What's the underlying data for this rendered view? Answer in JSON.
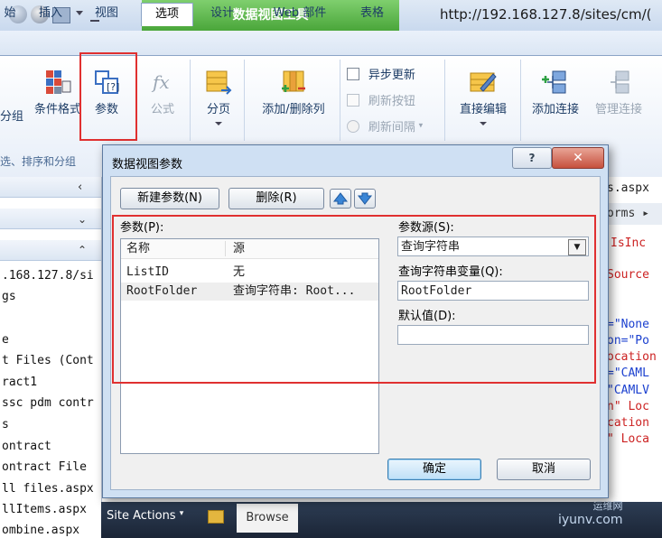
{
  "window": {
    "tool_tab": "数据视图工具",
    "url": "http://192.168.127.8/sites/cm/("
  },
  "ribbon_tabs": [
    {
      "label": "始"
    },
    {
      "label": "插入"
    },
    {
      "label": "视图"
    },
    {
      "label": "选项",
      "active": true
    },
    {
      "label": "设计"
    },
    {
      "label": "Web 部件"
    },
    {
      "label": "表格"
    }
  ],
  "ribbon": {
    "fen_zu": "分组",
    "conditional_format": "条件格式",
    "parameters": "参数",
    "formula": "公式",
    "paging": "分页",
    "add_remove_columns": "添加/删除列",
    "async_update": "异步更新",
    "refresh_button": "刷新按钮",
    "refresh_interval": "刷新间隔",
    "inline_edit": "直接编辑",
    "add_connection": "添加连接",
    "manage_connection": "管理连接",
    "group_label": "选、排序和分组"
  },
  "left_panel": {
    "lines": [
      ".168.127.8/si",
      "gs",
      "e",
      "t Files (Cont",
      "ract1",
      "ssc pdm contr",
      "s",
      "ontract",
      "ontract File",
      "ll files.aspx",
      "llItems.aspx",
      "ombine.aspx"
    ]
  },
  "right_panel": {
    "tab_label": "s.aspx",
    "breadcrumb": "orms",
    "lines": [
      {
        "text": "IsInc",
        "color": "#cc2222"
      },
      {
        "text": "Source",
        "color": "#cc2222"
      },
      {
        "text": "=\"None",
        "color": "#1a3fcf"
      },
      {
        "text": "on=\"Po",
        "color": "#1a3fcf"
      },
      {
        "text": "ocation",
        "color": "#cc2222"
      },
      {
        "text": "=\"CAML",
        "color": "#1a3fcf"
      },
      {
        "text": "\"CAMLV",
        "color": "#1a3fcf"
      },
      {
        "text": "n\" Loc",
        "color": "#cc2222"
      },
      {
        "text": "cation",
        "color": "#cc2222"
      },
      {
        "text": "\" Loca",
        "color": "#cc2222"
      }
    ]
  },
  "dialog": {
    "title": "数据视图参数",
    "help_label": "?",
    "close_label": "✕",
    "new_param": "新建参数(N)",
    "delete": "删除(R)",
    "params_label": "参数(P):",
    "list_headers": [
      "名称",
      "源"
    ],
    "rows": [
      {
        "name": "ListID",
        "source": "无"
      },
      {
        "name": "RootFolder",
        "source": "查询字符串: Root..."
      }
    ],
    "source_label": "参数源(S):",
    "source_value": "查询字符串",
    "qs_var_label": "查询字符串变量(Q):",
    "qs_var_value": "RootFolder",
    "default_label": "默认值(D):",
    "default_value": "",
    "ok": "确定",
    "cancel": "取消"
  },
  "bottom_bar": {
    "site_actions": "Site Actions",
    "browse_tab": "Browse"
  },
  "watermark": {
    "line1": "运维网",
    "line2": "iyunv.com"
  }
}
